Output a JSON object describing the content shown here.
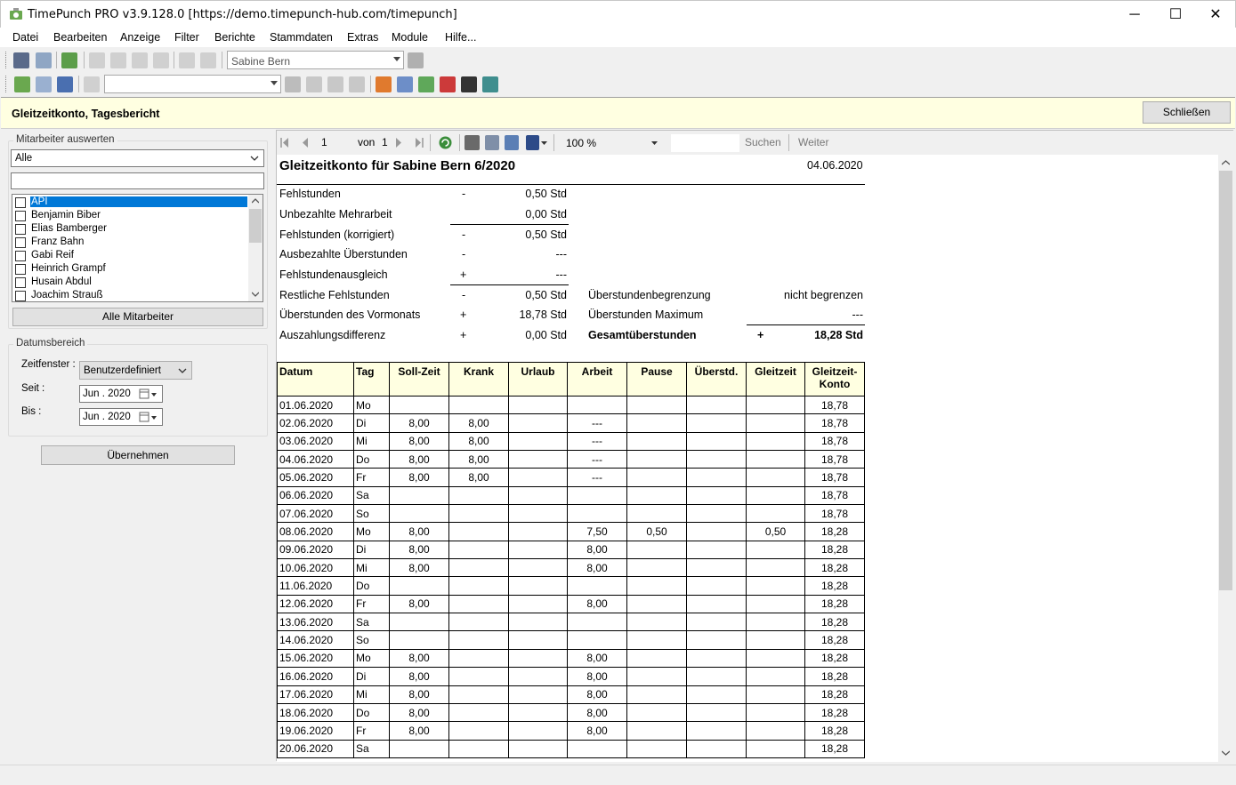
{
  "window": {
    "title": "TimePunch PRO v3.9.128.0 [https://demo.timepunch-hub.com/timepunch]",
    "minimize": "─",
    "maximize": "☐",
    "close": "✕"
  },
  "menu": [
    "Datei",
    "Bearbeiten",
    "Anzeige",
    "Filter",
    "Berichte",
    "Stammdaten",
    "Extras",
    "Module",
    "Hilfe..."
  ],
  "toolbar": {
    "employee_combo": "Sabine Bern",
    "second_combo": ""
  },
  "report_bar": {
    "title": "Gleitzeitkonto, Tagesbericht",
    "close_label": "Schließen"
  },
  "left": {
    "employee_group": "Mitarbeiter auswerten",
    "employee_filter": "Alle",
    "search_value": "",
    "employees": [
      "API",
      "Benjamin Biber",
      "Elias Bamberger",
      "Franz Bahn",
      "Gabi Reif",
      "Heinrich Grampf",
      "Husain Abdul",
      "Joachim Strauß"
    ],
    "all_button": "Alle Mitarbeiter",
    "date_group": "Datumsbereich",
    "zeitfenster_label": "Zeitfenster :",
    "zeitfenster_value": "Benutzerdefiniert",
    "seit_label": "Seit :",
    "seit_value": "Jun . 2020",
    "bis_label": "Bis :",
    "bis_value": "Jun . 2020",
    "apply_button": "Übernehmen"
  },
  "viewer_toolbar": {
    "page": "1",
    "of_label": "von",
    "total": "1",
    "zoom": "100 %",
    "search_value": "",
    "search_label": "Suchen",
    "next_label": "Weiter"
  },
  "report": {
    "title": "Gleitzeitkonto für Sabine Bern 6/2020",
    "date": "04.06.2020",
    "summary_left": [
      {
        "label": "Fehlstunden",
        "sign": "-",
        "value": "0,50 Std"
      },
      {
        "label": "Unbezahlte Mehrarbeit",
        "sign": "",
        "value": "0,00 Std"
      },
      {
        "label": "Fehlstunden (korrigiert)",
        "sign": "-",
        "value": "0,50 Std"
      },
      {
        "label": "Ausbezahlte Überstunden",
        "sign": "-",
        "value": "---"
      },
      {
        "label": "Fehlstundenausgleich",
        "sign": "+",
        "value": "---"
      },
      {
        "label": "Restliche Fehlstunden",
        "sign": "-",
        "value": "0,50 Std"
      },
      {
        "label": "Überstunden des Vormonats",
        "sign": "+",
        "value": "18,78 Std"
      },
      {
        "label": "Auszahlungsdifferenz",
        "sign": "+",
        "value": "0,00 Std"
      }
    ],
    "summary_right": [
      {
        "label": "Überstundenbegrenzung",
        "sign": "",
        "value": "nicht begrenzen"
      },
      {
        "label": "Überstunden Maximum",
        "sign": "",
        "value": "---"
      },
      {
        "label": "Gesamtüberstunden",
        "sign": "+",
        "value": "18,28 Std"
      }
    ],
    "columns": [
      "Datum",
      "Tag",
      "Soll-Zeit",
      "Krank",
      "Urlaub",
      "Arbeit",
      "Pause",
      "Überstd.",
      "Gleitzeit",
      "Gleitzeit-Konto"
    ],
    "rows": [
      [
        "01.06.2020",
        "Mo",
        "",
        "",
        "",
        "",
        "",
        "",
        "",
        "18,78"
      ],
      [
        "02.06.2020",
        "Di",
        "8,00",
        "8,00",
        "",
        "---",
        "",
        "",
        "",
        "18,78"
      ],
      [
        "03.06.2020",
        "Mi",
        "8,00",
        "8,00",
        "",
        "---",
        "",
        "",
        "",
        "18,78"
      ],
      [
        "04.06.2020",
        "Do",
        "8,00",
        "8,00",
        "",
        "---",
        "",
        "",
        "",
        "18,78"
      ],
      [
        "05.06.2020",
        "Fr",
        "8,00",
        "8,00",
        "",
        "---",
        "",
        "",
        "",
        "18,78"
      ],
      [
        "06.06.2020",
        "Sa",
        "",
        "",
        "",
        "",
        "",
        "",
        "",
        "18,78"
      ],
      [
        "07.06.2020",
        "So",
        "",
        "",
        "",
        "",
        "",
        "",
        "",
        "18,78"
      ],
      [
        "08.06.2020",
        "Mo",
        "8,00",
        "",
        "",
        "7,50",
        "0,50",
        "",
        "0,50",
        "18,28"
      ],
      [
        "09.06.2020",
        "Di",
        "8,00",
        "",
        "",
        "8,00",
        "",
        "",
        "",
        "18,28"
      ],
      [
        "10.06.2020",
        "Mi",
        "8,00",
        "",
        "",
        "8,00",
        "",
        "",
        "",
        "18,28"
      ],
      [
        "11.06.2020",
        "Do",
        "",
        "",
        "",
        "",
        "",
        "",
        "",
        "18,28"
      ],
      [
        "12.06.2020",
        "Fr",
        "8,00",
        "",
        "",
        "8,00",
        "",
        "",
        "",
        "18,28"
      ],
      [
        "13.06.2020",
        "Sa",
        "",
        "",
        "",
        "",
        "",
        "",
        "",
        "18,28"
      ],
      [
        "14.06.2020",
        "So",
        "",
        "",
        "",
        "",
        "",
        "",
        "",
        "18,28"
      ],
      [
        "15.06.2020",
        "Mo",
        "8,00",
        "",
        "",
        "8,00",
        "",
        "",
        "",
        "18,28"
      ],
      [
        "16.06.2020",
        "Di",
        "8,00",
        "",
        "",
        "8,00",
        "",
        "",
        "",
        "18,28"
      ],
      [
        "17.06.2020",
        "Mi",
        "8,00",
        "",
        "",
        "8,00",
        "",
        "",
        "",
        "18,28"
      ],
      [
        "18.06.2020",
        "Do",
        "8,00",
        "",
        "",
        "8,00",
        "",
        "",
        "",
        "18,28"
      ],
      [
        "19.06.2020",
        "Fr",
        "8,00",
        "",
        "",
        "8,00",
        "",
        "",
        "",
        "18,28"
      ],
      [
        "20.06.2020",
        "Sa",
        "",
        "",
        "",
        "",
        "",
        "",
        "",
        "18,28"
      ]
    ]
  }
}
